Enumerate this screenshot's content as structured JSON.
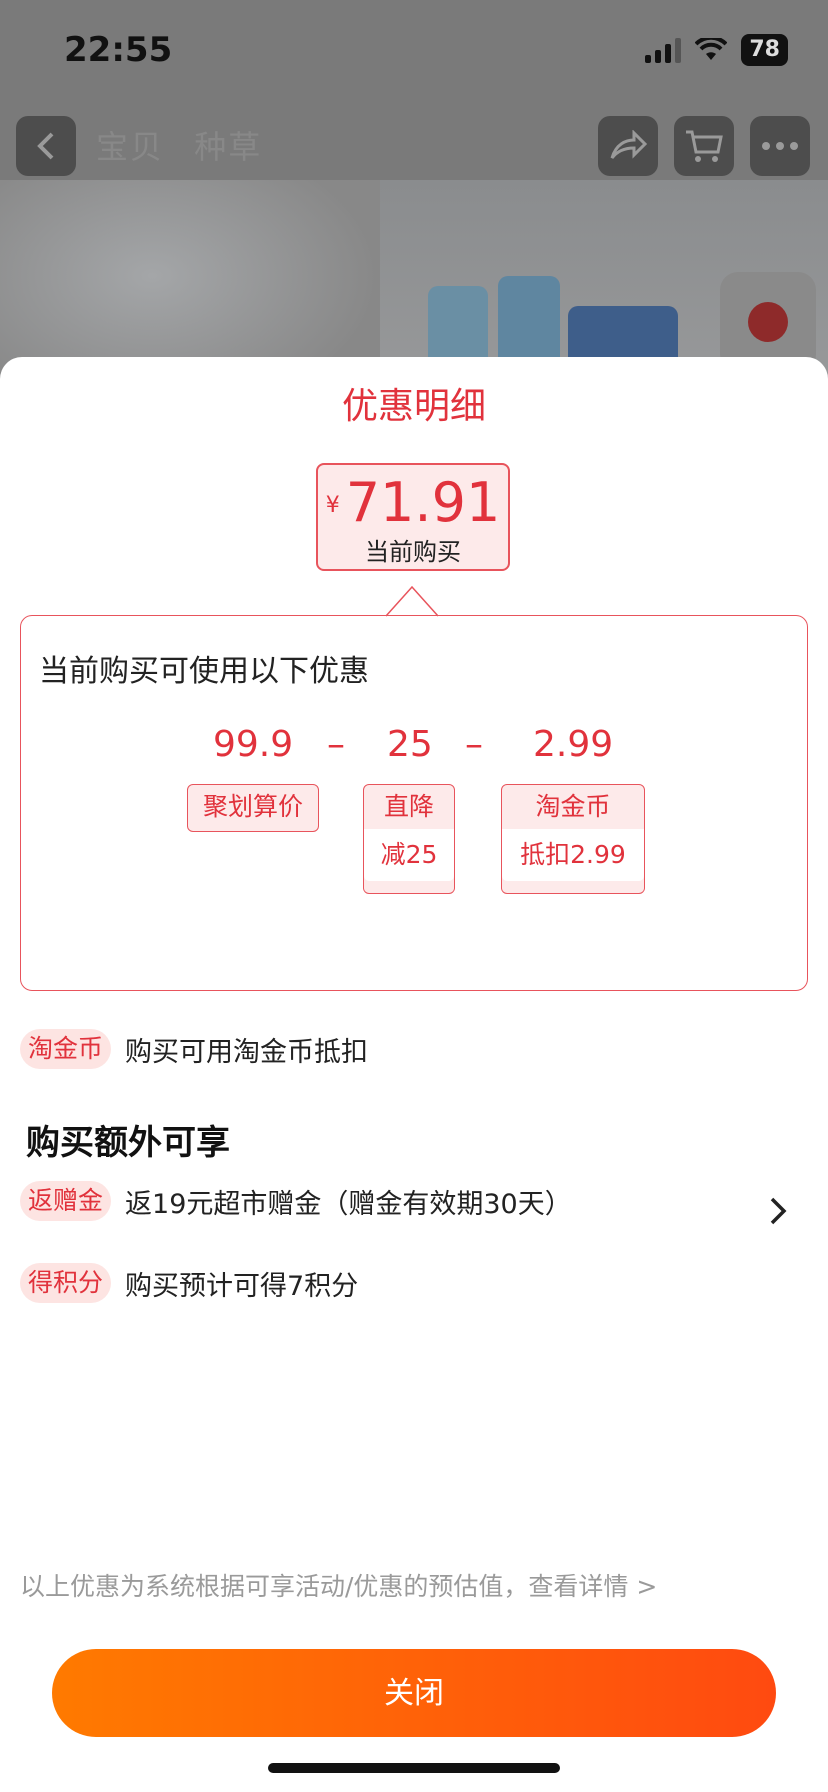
{
  "status_bar": {
    "time": "22:55",
    "battery": "78"
  },
  "topbar": {
    "tabs": [
      "宝贝",
      "种草"
    ]
  },
  "sheet": {
    "title": "优惠明细",
    "price": {
      "currency": "¥",
      "value": "71.91",
      "caption": "当前购买"
    },
    "detail": {
      "heading": "当前购买可使用以下优惠",
      "formula": [
        {
          "value": "99.9",
          "tag": "聚划算价",
          "sub": ""
        },
        {
          "value": "25",
          "tag": "直降",
          "sub": "减25"
        },
        {
          "value": "2.99",
          "tag": "淘金币",
          "sub": "抵扣2.99"
        }
      ],
      "minus": "–"
    },
    "coin_row": {
      "pill": "淘金币",
      "text": "购买可用淘金币抵扣"
    },
    "extra_title": "购买额外可享",
    "extras": [
      {
        "pill": "返赠金",
        "text": "返19元超市赠金（赠金有效期30天）",
        "has_arrow": true
      },
      {
        "pill": "得积分",
        "text": "购买预计可得7积分",
        "has_arrow": false
      }
    ],
    "note": "以上优惠为系统根据可享活动/优惠的预估值，查看详情 >",
    "close_label": "关闭"
  },
  "colors": {
    "accent": "#e1323c",
    "button_start": "#ff7a00",
    "button_end": "#ff4a10"
  }
}
